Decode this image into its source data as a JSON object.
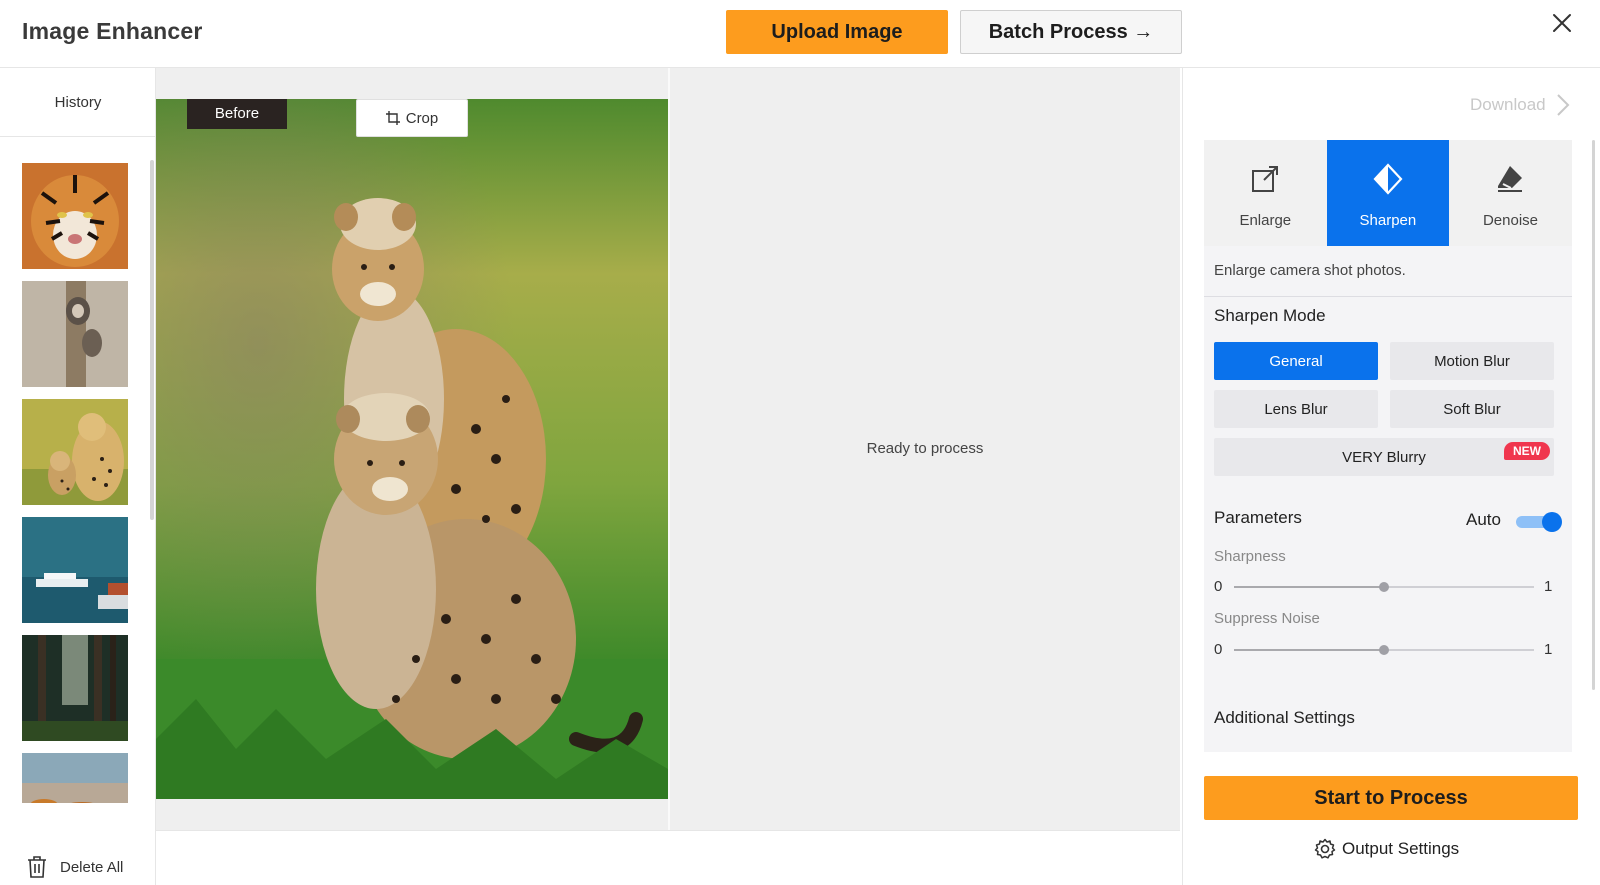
{
  "header": {
    "title": "Image Enhancer",
    "upload_label": "Upload Image",
    "batch_label": "Batch Process →"
  },
  "sidebar": {
    "history_label": "History",
    "delete_all_label": "Delete All",
    "thumbnails": [
      "tiger",
      "monkey-on-tree",
      "cheetah-with-cub",
      "boats-at-sea",
      "forest",
      "sunset-sky"
    ]
  },
  "canvas": {
    "before_label": "Before",
    "crop_label": "Crop",
    "ready_text": "Ready to process"
  },
  "panel": {
    "download_label": "Download",
    "tools": [
      {
        "label": "Enlarge",
        "icon": "enlarge-icon",
        "active": false
      },
      {
        "label": "Sharpen",
        "icon": "sharpen-icon",
        "active": true
      },
      {
        "label": "Denoise",
        "icon": "denoise-icon",
        "active": false
      }
    ],
    "description": "Enlarge camera shot photos.",
    "sharpen_mode_title": "Sharpen Mode",
    "modes": [
      {
        "label": "General",
        "active": true
      },
      {
        "label": "Motion Blur",
        "active": false
      },
      {
        "label": "Lens Blur",
        "active": false
      },
      {
        "label": "Soft Blur",
        "active": false
      },
      {
        "label": "VERY Blurry",
        "active": false,
        "badge": "NEW"
      }
    ],
    "parameters_title": "Parameters",
    "auto_label": "Auto",
    "auto_enabled": true,
    "sharpness": {
      "label": "Sharpness",
      "min": "0",
      "max": "1",
      "value": 0.5
    },
    "suppress_noise": {
      "label": "Suppress Noise",
      "min": "0",
      "max": "1",
      "value": 0.5
    },
    "additional_settings_title": "Additional Settings",
    "start_label": "Start to Process",
    "output_settings_label": "Output Settings"
  },
  "colors": {
    "accent_orange": "#fd9c1e",
    "accent_blue": "#0a72ec",
    "badge_red": "#f0364e"
  }
}
